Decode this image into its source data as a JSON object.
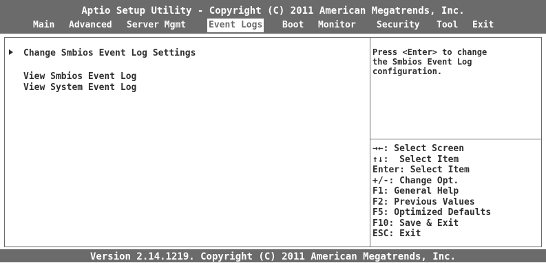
{
  "header": {
    "title": "Aptio Setup Utility - Copyright (C) 2011 American Megatrends, Inc."
  },
  "menu": {
    "active": "Event Logs",
    "items": [
      {
        "label": "Main"
      },
      {
        "label": "Advanced"
      },
      {
        "label": "Server Mgmt"
      },
      {
        "label": "Event Logs"
      },
      {
        "label": "Boot"
      },
      {
        "label": "Monitor"
      },
      {
        "label": "Security"
      },
      {
        "label": "Tool"
      },
      {
        "label": "Exit"
      }
    ]
  },
  "left_panel": {
    "items": [
      {
        "label": "Change Smbios Event Log Settings",
        "has_submenu": true
      },
      {
        "label": "View Smbios Event Log",
        "has_submenu": false
      },
      {
        "label": "View System Event Log",
        "has_submenu": false
      }
    ]
  },
  "help_panel": {
    "lines": [
      "Press <Enter> to change",
      "the Smbios Event Log",
      "configuration."
    ]
  },
  "key_legend": {
    "lines": [
      "→←: Select Screen",
      "↑↓:  Select Item",
      "Enter: Select Item",
      "+/-: Change Opt.",
      "F1: General Help",
      "F2: Previous Values",
      "F5: Optimized Defaults",
      "F10: Save & Exit",
      "ESC: Exit"
    ]
  },
  "footer": {
    "text": "Version 2.14.1219. Copyright (C) 2011 American Megatrends, Inc."
  },
  "colors": {
    "header_bg": "#6b6b6b",
    "header_text": "#ffffff",
    "body_bg": "#ffffff",
    "body_text": "#2f2f2f",
    "active_tab_bg": "#ffffff"
  }
}
